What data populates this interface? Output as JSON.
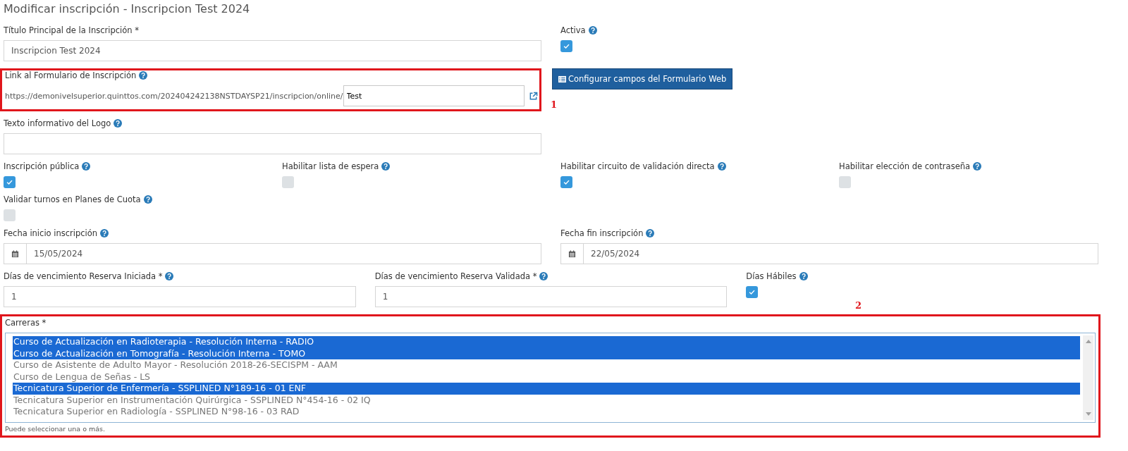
{
  "page_title": "Modificar inscripción - Inscripcion Test 2024",
  "title_field": {
    "label": "Título Principal de la Inscripción *",
    "value": "Inscripcion Test 2024"
  },
  "active": {
    "label": "Activa",
    "help": true,
    "checked": true
  },
  "form_link": {
    "label": "Link al Formulario de Inscripción",
    "help": true,
    "url_prefix": "https://demonivelsuperior.quinttos.com/202404242138NSTDAYSP21/inscripcion/online/",
    "value": "Test",
    "callout": "1"
  },
  "configure_button": "Configurar campos del Formulario Web",
  "logo_text": {
    "label": "Texto informativo del Logo",
    "help": true
  },
  "options": [
    {
      "label": "Inscripción pública",
      "help": true,
      "checked": true
    },
    {
      "label": "Habilitar lista de espera",
      "help": true,
      "checked": false
    },
    {
      "label": "Habilitar circuito de validación directa",
      "help": true,
      "checked": true
    },
    {
      "label": "Habilitar elección de contraseña",
      "help": true,
      "checked": false
    },
    {
      "label": "Validar turnos en Planes de Cuota",
      "help": true,
      "checked": false
    }
  ],
  "dates": [
    {
      "label": "Fecha inicio inscripción",
      "help": true,
      "value": "15/05/2024"
    },
    {
      "label": "Fecha fin inscripción",
      "help": true,
      "value": "22/05/2024"
    }
  ],
  "days_fields": [
    {
      "label": "Días de vencimiento Reserva Iniciada *",
      "help": true,
      "value": "1"
    },
    {
      "label": "Días de vencimiento Reserva Validada *",
      "help": true,
      "value": "1"
    }
  ],
  "business_days": {
    "label": "Días Hábiles",
    "help": true,
    "checked": true
  },
  "careers": {
    "label": "Carreras *",
    "callout": "2",
    "hint": "Puede seleccionar una o más.",
    "items": [
      {
        "label": "Curso de Actualización en Radioterapia - Resolución Interna - RADIO",
        "selected": true
      },
      {
        "label": "Curso de Actualización en Tomografía - Resolución Interna - TOMO",
        "selected": true
      },
      {
        "label": "Curso de Asistente de Adulto Mayor - Resolución 2018-26-SECISPM - AAM",
        "selected": false
      },
      {
        "label": "Curso de Lengua de Señas - LS",
        "selected": false
      },
      {
        "label": "Tecnicatura Superior de Enfermería - SSPLINED N°189-16 - 01 ENF",
        "selected": true
      },
      {
        "label": "Tecnicatura Superior en Instrumentación Quirúrgica - SSPLINED N°454-16 - 02 IQ",
        "selected": false
      },
      {
        "label": "Tecnicatura Superior en Radiología - SSPLINED N°98-16 - 03 RAD",
        "selected": false
      }
    ]
  }
}
